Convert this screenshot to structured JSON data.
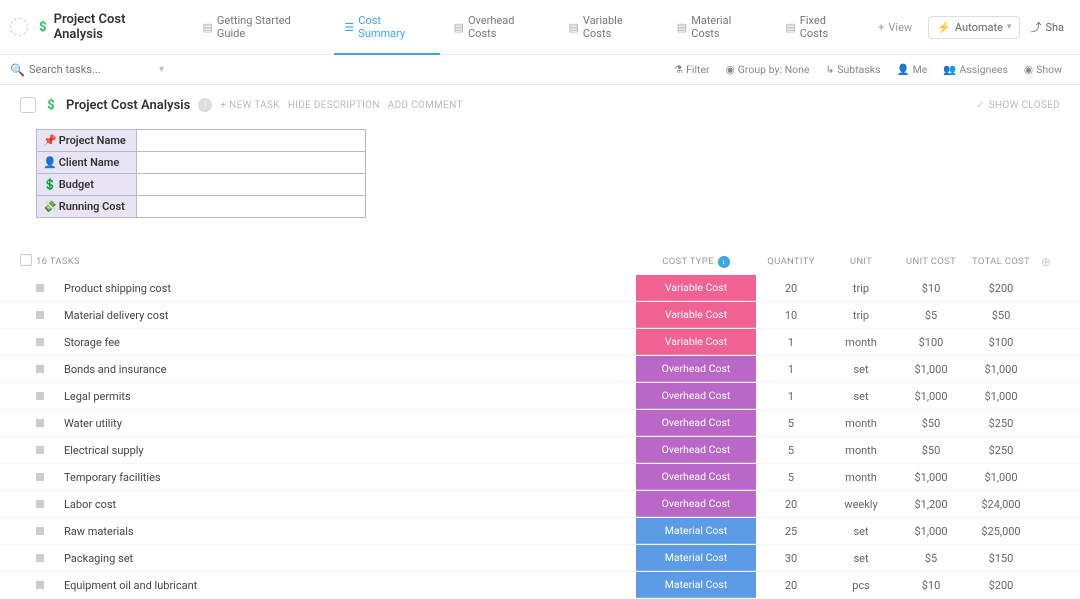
{
  "top": {
    "folder_title": "Project Cost Analysis",
    "tabs": [
      {
        "label": "Getting Started Guide"
      },
      {
        "label": "Cost Summary"
      },
      {
        "label": "Overhead Costs"
      },
      {
        "label": "Variable Costs"
      },
      {
        "label": "Material Costs"
      },
      {
        "label": "Fixed Costs"
      }
    ],
    "view_label": "View",
    "automate_label": "Automate",
    "share_label": "Sha"
  },
  "toolbar": {
    "search_placeholder": "Search tasks...",
    "filter": "Filter",
    "group_by": "Group by: None",
    "subtasks": "Subtasks",
    "me": "Me",
    "assignees": "Assignees",
    "show": "Show"
  },
  "page": {
    "title": "Project Cost Analysis",
    "new_task": "+ NEW TASK",
    "hide_desc": "HIDE DESCRIPTION",
    "add_comment": "ADD COMMENT",
    "show_closed": "SHOW CLOSED"
  },
  "summary_rows": [
    {
      "emoji": "📌",
      "label": "Project Name",
      "value": ""
    },
    {
      "emoji": "👤",
      "label": "Client Name",
      "value": ""
    },
    {
      "emoji": "💲",
      "label": "Budget",
      "value": ""
    },
    {
      "emoji": "💸",
      "label": "Running Cost",
      "value": ""
    }
  ],
  "grid": {
    "task_count_label": "16 TASKS",
    "cols": {
      "cost_type": "COST TYPE",
      "quantity": "QUANTITY",
      "unit": "UNIT",
      "unit_cost": "UNIT COST",
      "total_cost": "TOTAL COST"
    }
  },
  "tasks": [
    {
      "name": "Product shipping cost",
      "cost_type": "Variable Cost",
      "ct_class": "variable",
      "qty": "20",
      "unit": "trip",
      "unit_cost": "$10",
      "total": "$200"
    },
    {
      "name": "Material delivery cost",
      "cost_type": "Variable Cost",
      "ct_class": "variable",
      "qty": "10",
      "unit": "trip",
      "unit_cost": "$5",
      "total": "$50"
    },
    {
      "name": "Storage fee",
      "cost_type": "Variable Cost",
      "ct_class": "variable",
      "qty": "1",
      "unit": "month",
      "unit_cost": "$100",
      "total": "$100"
    },
    {
      "name": "Bonds and insurance",
      "cost_type": "Overhead Cost",
      "ct_class": "overhead",
      "qty": "1",
      "unit": "set",
      "unit_cost": "$1,000",
      "total": "$1,000"
    },
    {
      "name": "Legal permits",
      "cost_type": "Overhead Cost",
      "ct_class": "overhead",
      "qty": "1",
      "unit": "set",
      "unit_cost": "$1,000",
      "total": "$1,000"
    },
    {
      "name": "Water utility",
      "cost_type": "Overhead Cost",
      "ct_class": "overhead",
      "qty": "5",
      "unit": "month",
      "unit_cost": "$50",
      "total": "$250"
    },
    {
      "name": "Electrical supply",
      "cost_type": "Overhead Cost",
      "ct_class": "overhead",
      "qty": "5",
      "unit": "month",
      "unit_cost": "$50",
      "total": "$250"
    },
    {
      "name": "Temporary facilities",
      "cost_type": "Overhead Cost",
      "ct_class": "overhead",
      "qty": "5",
      "unit": "month",
      "unit_cost": "$1,000",
      "total": "$1,000"
    },
    {
      "name": "Labor cost",
      "cost_type": "Overhead Cost",
      "ct_class": "overhead",
      "qty": "20",
      "unit": "weekly",
      "unit_cost": "$1,200",
      "total": "$24,000"
    },
    {
      "name": "Raw materials",
      "cost_type": "Material Cost",
      "ct_class": "material",
      "qty": "25",
      "unit": "set",
      "unit_cost": "$1,000",
      "total": "$25,000"
    },
    {
      "name": "Packaging set",
      "cost_type": "Material Cost",
      "ct_class": "material",
      "qty": "30",
      "unit": "set",
      "unit_cost": "$5",
      "total": "$150"
    },
    {
      "name": "Equipment oil and lubricant",
      "cost_type": "Material Cost",
      "ct_class": "material",
      "qty": "20",
      "unit": "pcs",
      "unit_cost": "$10",
      "total": "$200"
    }
  ],
  "cost_type_colors": {
    "variable": "#f06292",
    "overhead": "#ba68c8",
    "material": "#5c9ce6"
  },
  "chart_data": {
    "type": "table",
    "title": "Cost Summary",
    "columns": [
      "Task",
      "Cost Type",
      "Quantity",
      "Unit",
      "Unit Cost",
      "Total Cost"
    ],
    "rows": [
      [
        "Product shipping cost",
        "Variable Cost",
        20,
        "trip",
        10,
        200
      ],
      [
        "Material delivery cost",
        "Variable Cost",
        10,
        "trip",
        5,
        50
      ],
      [
        "Storage fee",
        "Variable Cost",
        1,
        "month",
        100,
        100
      ],
      [
        "Bonds and insurance",
        "Overhead Cost",
        1,
        "set",
        1000,
        1000
      ],
      [
        "Legal permits",
        "Overhead Cost",
        1,
        "set",
        1000,
        1000
      ],
      [
        "Water utility",
        "Overhead Cost",
        5,
        "month",
        50,
        250
      ],
      [
        "Electrical supply",
        "Overhead Cost",
        5,
        "month",
        50,
        250
      ],
      [
        "Temporary facilities",
        "Overhead Cost",
        5,
        "month",
        1000,
        1000
      ],
      [
        "Labor cost",
        "Overhead Cost",
        20,
        "weekly",
        1200,
        24000
      ],
      [
        "Raw materials",
        "Material Cost",
        25,
        "set",
        1000,
        25000
      ],
      [
        "Packaging set",
        "Material Cost",
        30,
        "set",
        5,
        150
      ],
      [
        "Equipment oil and lubricant",
        "Material Cost",
        20,
        "pcs",
        10,
        200
      ]
    ]
  }
}
